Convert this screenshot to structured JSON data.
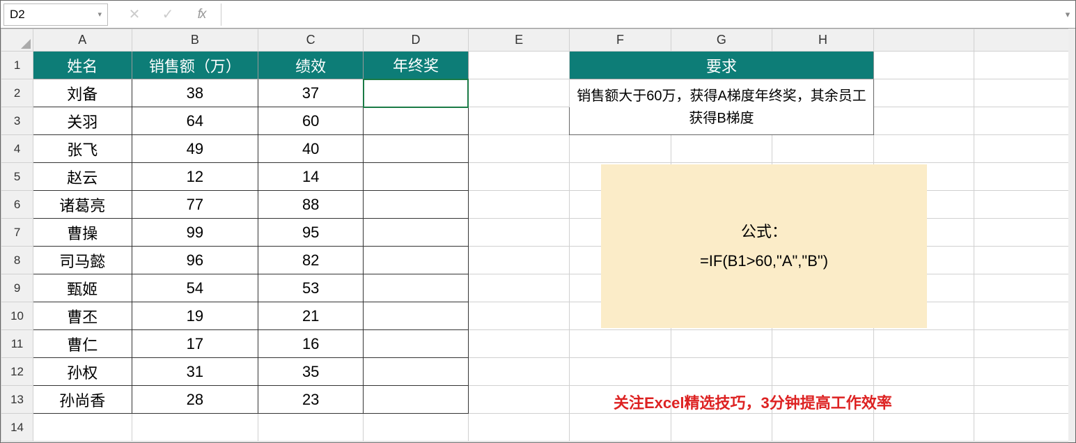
{
  "namebox": {
    "value": "D2"
  },
  "formula_bar": {
    "value": ""
  },
  "columns": [
    "A",
    "B",
    "C",
    "D",
    "E",
    "F",
    "G",
    "H"
  ],
  "row_numbers": [
    1,
    2,
    3,
    4,
    5,
    6,
    7,
    8,
    9,
    10,
    11,
    12,
    13,
    14
  ],
  "main_table": {
    "headers": [
      "姓名",
      "销售额（万）",
      "绩效",
      "年终奖"
    ],
    "rows": [
      {
        "name": "刘备",
        "sales": "38",
        "perf": "37",
        "bonus": ""
      },
      {
        "name": "关羽",
        "sales": "64",
        "perf": "60",
        "bonus": ""
      },
      {
        "name": "张飞",
        "sales": "49",
        "perf": "40",
        "bonus": ""
      },
      {
        "name": "赵云",
        "sales": "12",
        "perf": "14",
        "bonus": ""
      },
      {
        "name": "诸葛亮",
        "sales": "77",
        "perf": "88",
        "bonus": ""
      },
      {
        "name": "曹操",
        "sales": "99",
        "perf": "95",
        "bonus": ""
      },
      {
        "name": "司马懿",
        "sales": "96",
        "perf": "82",
        "bonus": ""
      },
      {
        "name": "甄姬",
        "sales": "54",
        "perf": "53",
        "bonus": ""
      },
      {
        "name": "曹丕",
        "sales": "19",
        "perf": "21",
        "bonus": ""
      },
      {
        "name": "曹仁",
        "sales": "17",
        "perf": "16",
        "bonus": ""
      },
      {
        "name": "孙权",
        "sales": "31",
        "perf": "35",
        "bonus": ""
      },
      {
        "name": "孙尚香",
        "sales": "28",
        "perf": "23",
        "bonus": ""
      }
    ]
  },
  "requirement": {
    "title": "要求",
    "text": "销售额大于60万，获得A梯度年终奖，其余员工获得B梯度"
  },
  "formula_box": {
    "label": "公式：",
    "formula": "=IF(B1>60,\"A\",\"B\")"
  },
  "footer": "关注Excel精选技巧，3分钟提高工作效率",
  "icons": {
    "dropdown": "▾",
    "cancel": "✕",
    "enter": "✓",
    "fx": "fx",
    "expand": "▾"
  }
}
